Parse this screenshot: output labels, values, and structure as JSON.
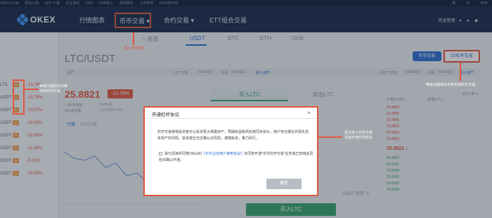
{
  "topbar": {
    "left_items": [
      "OKEX.COM",
      "网站公告",
      "APP 下载",
      "关注我们",
      "OKB",
      "OKB收入",
      "机构服务",
      "上币申请",
      "OK内容平台"
    ],
    "right_items": [
      "英",
      "中",
      "APP"
    ]
  },
  "nav": {
    "logo_text": "OKEX",
    "items": {
      "charts": "行情图表",
      "spot": "币币交易",
      "spot_caret": "▾",
      "contracts": "合约交易",
      "contracts_caret": "▾",
      "etf": "ETT组合交易"
    },
    "right": [
      "资金管理",
      "▾"
    ]
  },
  "coin_tabs": {
    "favorites": "自选",
    "usdt": "USDT",
    "btc": "BTC",
    "eth": "ETH",
    "okb": "OKB"
  },
  "pair": {
    "title": "LTC/USDT"
  },
  "mode": {
    "spot": "币币交易",
    "margin": "3X杠杆交易"
  },
  "asset_bar": {
    "label": "资产",
    "ltc_label": "LTC 可用",
    "ltc_val": "0.000000",
    "usdt_label": "冻结",
    "usdt_val": "0.000000",
    "transfer": "转入资产",
    "usdt2_label": "USDT 可用",
    "usdt2_val": "0.000000",
    "usdt2_frozen_label": "冻结",
    "usdt2_frozen_val": "0.000000",
    "transfer2": "转入资产"
  },
  "ticker": {
    "price": "25.8821",
    "change": "-13.78%",
    "label1": "人民币估值",
    "val1": "¥179.31",
    "label2": "24h成交量",
    "val2": "1,371,831 LTC"
  },
  "trade_tabs": {
    "buy": "买入LTC",
    "sell": "卖出LTC"
  },
  "chart_tabs": [
    "行情",
    "LTC介绍"
  ],
  "left_list": [
    {
      "name": "LTC",
      "badge": "3X",
      "change": "-13.78%"
    },
    {
      "name": "USDT",
      "badge": "3X",
      "change": "-12.76%"
    },
    {
      "name": "USDT",
      "badge": "3X",
      "change": "-10.57%"
    },
    {
      "name": "USDT",
      "badge": "3X",
      "change": "-16.09%"
    },
    {
      "name": "USDT",
      "badge": "3X",
      "change": "-21.66%"
    },
    {
      "name": "USDT",
      "badge": "3X",
      "change": "-11.36%"
    },
    {
      "name": "USDT",
      "badge": "3X",
      "change": "-5.02%"
    },
    {
      "name": "USDT",
      "badge": "3X",
      "change": "-20.39%"
    }
  ],
  "book": {
    "head_price": "价格(USDT)",
    "head_amount": "数量(LTC)",
    "head_right": "4位小数 ▾",
    "asks": [
      {
        "p": "25.8893",
        "v": ""
      },
      {
        "p": "25.8865",
        "v": ""
      },
      {
        "p": "25.8845",
        "v": ""
      },
      {
        "p": "25.8842",
        "v": ""
      },
      {
        "p": "25.8839",
        "v": ""
      },
      {
        "p": "25.8830",
        "v": ""
      }
    ],
    "mid": "25.8821 ↓",
    "bids": [
      {
        "p": "25.8820",
        "v": ""
      },
      {
        "p": "25.8641",
        "v": ""
      },
      {
        "p": "25.8408",
        "v": ""
      },
      {
        "p": "25.8405",
        "v": ""
      },
      {
        "p": "25.8390",
        "v": ""
      },
      {
        "p": "25.8388",
        "v": ""
      }
    ]
  },
  "form": {
    "avail": "USDT 可用: 0",
    "buy_button": "买入LTC"
  },
  "annotations": {
    "spot": "进入币币交易",
    "left_list": "带有3x图标的币种\n支持杠杆交易",
    "right_mode": "带有3x图标的币种支持杠杆交易",
    "modal": "首次进入杠杆交易\n勾选开通杠杆协议"
  },
  "modal": {
    "title": "开通杠杆协议",
    "close": "×",
    "body": "杠杆交易使得投资者可以投资更大规模资产，预期收益和风险被同步放大，用户存在爆仓并损失自有资产的风险，投资者应当正确认识风险，谨慎投资，量力而行。",
    "agree_prefix": "我已阅读并同意OKEx的",
    "agree_link": "《币币业务用户使用协议》",
    "agree_suffix": "并同意开通\"币币杠杆交易\"业务我已知晓此风险并确认开通。",
    "ok": "确定"
  },
  "colors": {
    "nav_bg": "#142846",
    "accent_blue": "#2a6fd4",
    "red": "#e2553b",
    "green": "#35a36b"
  }
}
